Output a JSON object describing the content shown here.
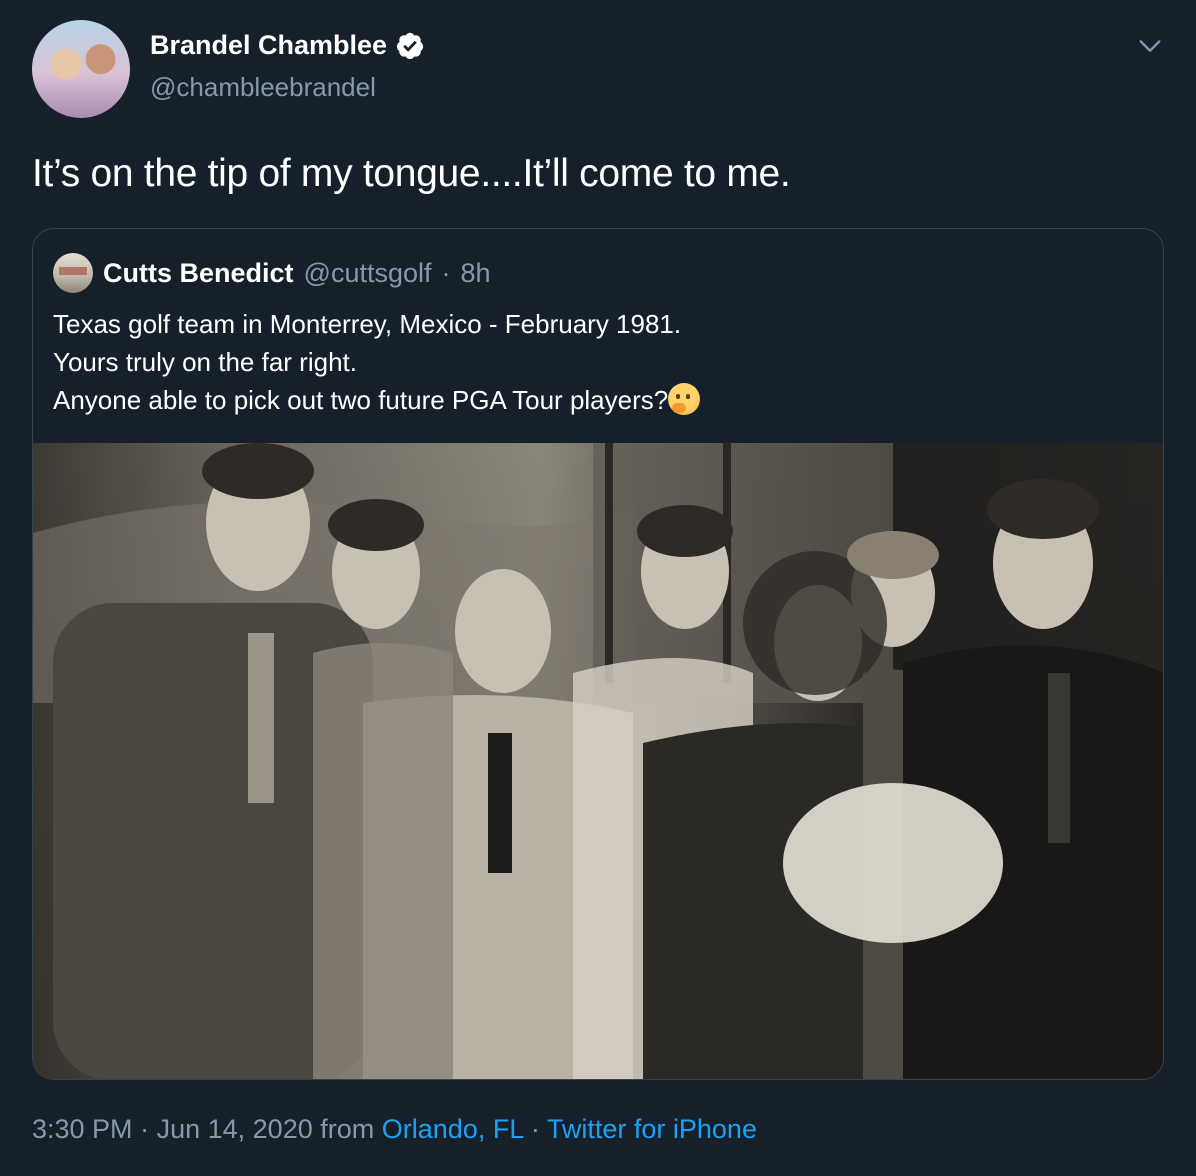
{
  "author": {
    "name": "Brandel Chamblee",
    "handle": "@chambleebrandel"
  },
  "tweet": {
    "text": "It’s on the tip of my tongue....It’ll come to me."
  },
  "quoted_tweet": {
    "name": "Cutts Benedict",
    "handle": "@cuttsgolf",
    "separator": "·",
    "time": "8h",
    "lines": [
      "Texas golf team in Monterrey, Mexico - February 1981.",
      "Yours truly on the far right.",
      "Anyone able to pick out two future PGA Tour players?"
    ],
    "emoji": "thinking-face"
  },
  "footer": {
    "time": "3:30 PM",
    "sep1": "·",
    "date": "Jun 14, 2020",
    "from_label": "from",
    "location": "Orlando, FL",
    "sep2": "·",
    "source": "Twitter for iPhone"
  },
  "colors": {
    "background": "#15202b",
    "secondary_text": "#8899a6",
    "link": "#1da1f2",
    "verified": "#ffffff",
    "border": "#38444d"
  },
  "icons": [
    "verified-badge-icon",
    "chevron-down-icon",
    "thinking-face-emoji"
  ]
}
